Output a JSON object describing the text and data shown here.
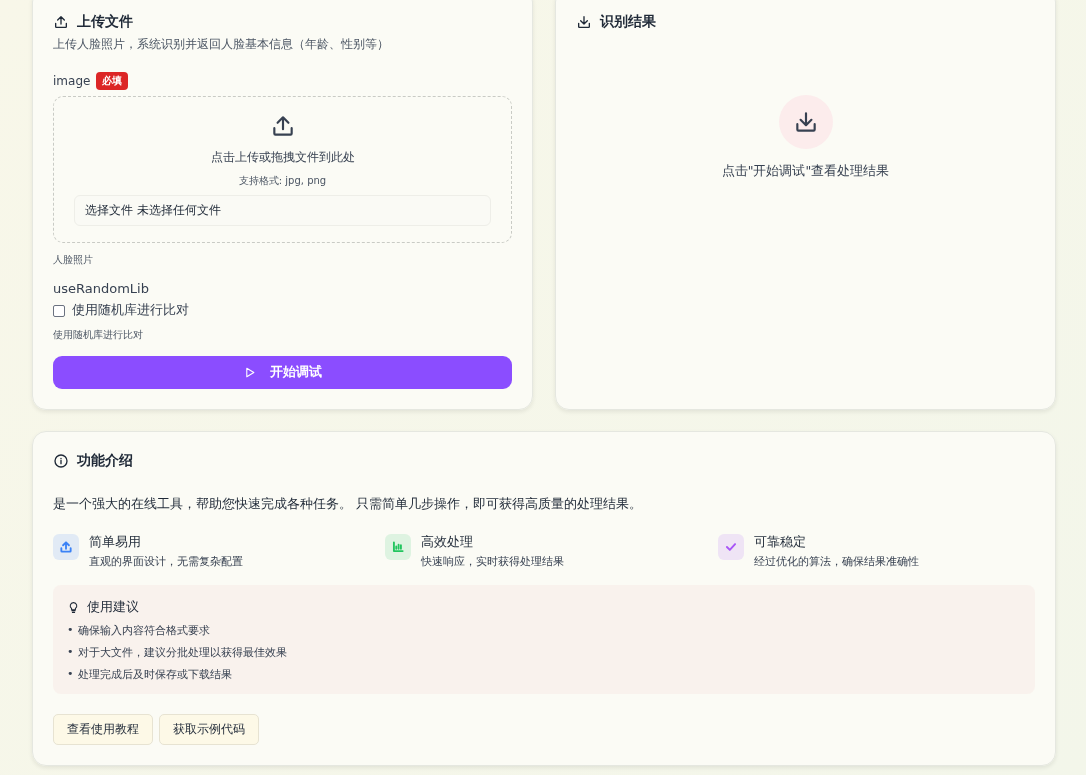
{
  "upload_card": {
    "title": "上传文件",
    "subtitle": "上传人脸照片，系统识别并返回人脸基本信息（年龄、性别等）",
    "fields": [
      {
        "kind": "file",
        "label": "image",
        "required_badge": "必填",
        "drop_text": "点击上传或拖拽文件到此处",
        "formats": "支持格式: jpg, png",
        "file_button": "选择文件",
        "file_status": "未选择任何文件",
        "hint": "人脸照片"
      },
      {
        "kind": "checkbox",
        "label": "useRandomLib",
        "checkbox_label": "使用随机库进行比对",
        "checked": false,
        "hint": "使用随机库进行比对"
      }
    ],
    "submit": "开始调试"
  },
  "result_card": {
    "title": "识别结果",
    "empty_text": "点击\"开始调试\"查看处理结果"
  },
  "intro_card": {
    "title": "功能介绍",
    "description": "是一个强大的在线工具，帮助您快速完成各种任务。 只需简单几步操作，即可获得高质量的处理结果。",
    "features": [
      {
        "kind": "upload",
        "title": "简单易用",
        "text": "直观的界面设计，无需复杂配置",
        "color": "#3b82f6"
      },
      {
        "kind": "chart",
        "title": "高效处理",
        "text": "快速响应，实时获得处理结果",
        "color": "#22c55e"
      },
      {
        "kind": "check",
        "title": "可靠稳定",
        "text": "经过优化的算法，确保结果准确性",
        "color": "#a855f7"
      }
    ],
    "tips": {
      "title": "使用建议",
      "items": [
        {
          "bullet": "•",
          "text": "确保输入内容符合格式要求"
        },
        {
          "bullet": "•",
          "text": "对于大文件，建议分批处理以获得最佳效果"
        },
        {
          "bullet": "•",
          "text": "处理完成后及时保存或下载结果"
        }
      ]
    },
    "buttons": [
      "查看使用教程",
      "获取示例代码"
    ]
  }
}
